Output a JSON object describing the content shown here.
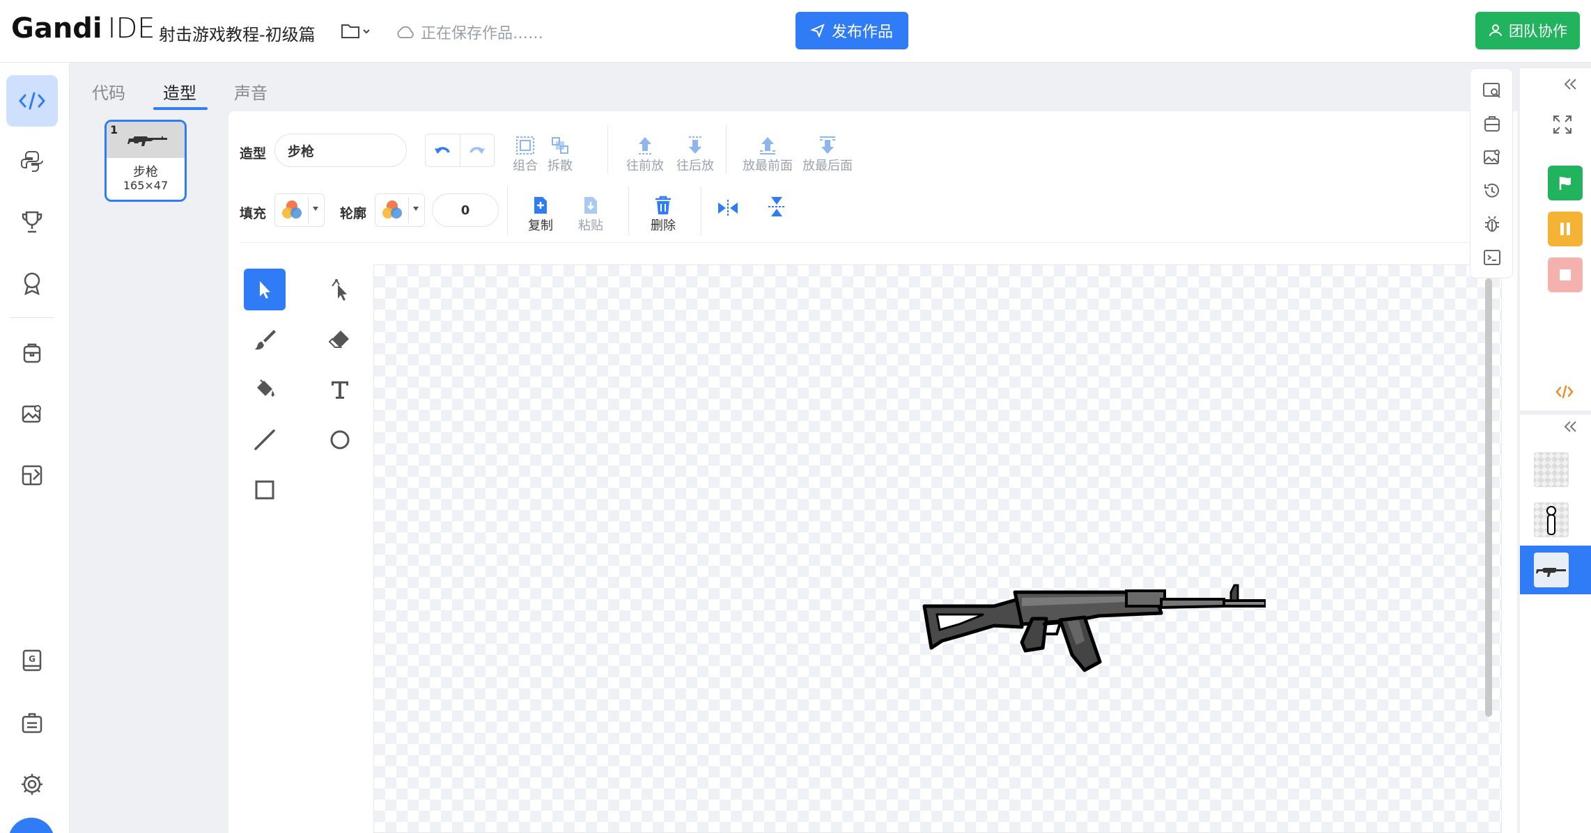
{
  "app": {
    "logo_bold": "Gandi",
    "logo_light": "IDE",
    "project_title": "射击游戏教程-初级篇",
    "save_status": "正在保存作品……",
    "publish_label": "发布作品",
    "team_label": "团队协作"
  },
  "tabs": [
    {
      "label": "代码"
    },
    {
      "label": "造型"
    },
    {
      "label": "声音"
    }
  ],
  "costume": {
    "index": "1",
    "name": "步枪",
    "size": "165×47"
  },
  "toolbar": {
    "costume_label": "造型",
    "costume_name_value": "步枪",
    "fill_label": "填充",
    "outline_label": "轮廓",
    "outline_width": "0",
    "group": "组合",
    "ungroup": "拆散",
    "forward": "往前放",
    "backward": "往后放",
    "front": "放最前面",
    "back": "放最后面",
    "copy": "复制",
    "paste": "粘贴",
    "delete": "删除"
  },
  "colors": {
    "accent": "#2f7cf6",
    "green": "#22b35e",
    "pause": "#f5b335",
    "stop": "#f4b1ae",
    "code_orange": "#f08a24"
  },
  "icons": {
    "code": "code-icon",
    "python": "python-icon",
    "trophy": "trophy-icon",
    "badge": "badge-icon",
    "backpack": "backpack-icon",
    "image": "image-icon",
    "design": "design-icon"
  }
}
